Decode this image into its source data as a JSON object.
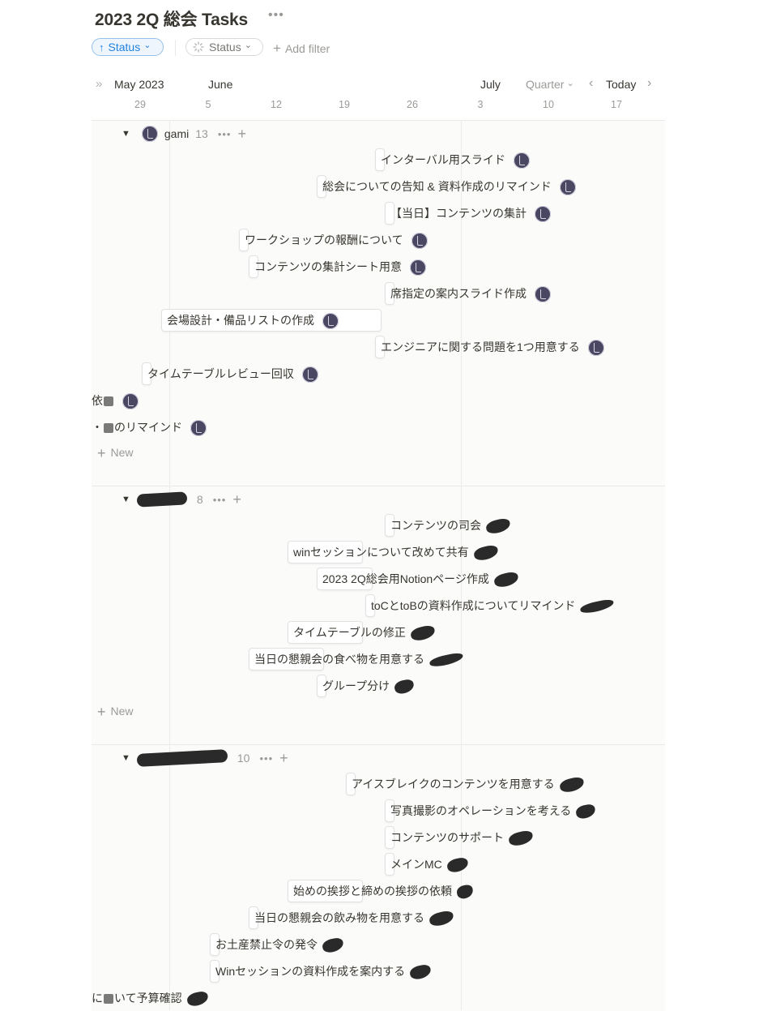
{
  "page": {
    "title": "2023 2Q 総会 Tasks",
    "more_icon": "ellipsis-icon",
    "more_label": "•••"
  },
  "toolbar": {
    "sort_chip": {
      "icon": "arrow-up-icon",
      "arrow": "↑",
      "label": "Status",
      "caret": "⌄"
    },
    "filter_chip": {
      "icon": "loading-status-icon",
      "label": "Status",
      "caret": "⌄"
    },
    "add_filter": {
      "plus": "+",
      "label": "Add filter"
    }
  },
  "timeline": {
    "collapse_icon": "»",
    "months": [
      {
        "label": "May 2023"
      },
      {
        "label": "June"
      },
      {
        "label": "July"
      }
    ],
    "zoom_select": {
      "label": "Quarter",
      "caret": "⌄"
    },
    "prev_icon": "‹",
    "today_label": "Today",
    "next_icon": "›",
    "days": [
      "29",
      "5",
      "12",
      "19",
      "26",
      "3",
      "10",
      "17"
    ]
  },
  "colors": {
    "accent": "#2383e2",
    "board_bg": "#fbfbfa",
    "text": "#37352f",
    "muted": "#9b9a97"
  },
  "groups": [
    {
      "name": "gami",
      "name_redacted": false,
      "count": "13",
      "more": "•••",
      "add": "+",
      "new_label": "New",
      "tasks": [
        {
          "title": "インターバル用スライド"
        },
        {
          "title": "総会についての告知 & 資料作成のリマインド"
        },
        {
          "title": "【当日】コンテンツの集計"
        },
        {
          "title": "ワークショップの報酬について"
        },
        {
          "title": "コンテンツの集計シート用意"
        },
        {
          "title": "席指定の案内スライド作成"
        },
        {
          "title": "会場設計・備品リストの作成"
        },
        {
          "title": "エンジニアに関する問題を1つ用意する"
        },
        {
          "title": "タイムテーブルレビュー回収"
        },
        {
          "title_prefix": "依",
          "title_suffix": ""
        },
        {
          "title_prefix": "・",
          "title_suffix": "のリマインド"
        }
      ]
    },
    {
      "name": "",
      "name_redacted": true,
      "count": "8",
      "more": "•••",
      "add": "+",
      "new_label": "New",
      "tasks": [
        {
          "title": "コンテンツの司会"
        },
        {
          "title": "winセッションについて改めて共有"
        },
        {
          "title": "2023 2Q総会用Notionページ作成"
        },
        {
          "title": "toCとtoBの資料作成についてリマインド"
        },
        {
          "title": "タイムテーブルの修正"
        },
        {
          "title": "当日の懇親会の食べ物を用意する"
        },
        {
          "title": "グループ分け"
        }
      ]
    },
    {
      "name": "",
      "name_redacted": true,
      "count": "10",
      "more": "•••",
      "add": "+",
      "tasks": [
        {
          "title": "アイスブレイクのコンテンツを用意する"
        },
        {
          "title": "写真撮影のオペレーションを考える"
        },
        {
          "title": "コンテンツのサポート"
        },
        {
          "title": "メインMC"
        },
        {
          "title": "始めの挨拶と締めの挨拶の依頼"
        },
        {
          "title": "当日の懇親会の飲み物を用意する"
        },
        {
          "title": "お土産禁止令の発令"
        },
        {
          "title": "Winセッションの資料作成を案内する"
        },
        {
          "title_prefix": "に",
          "title_suffix": "いて予算確認"
        }
      ]
    }
  ]
}
